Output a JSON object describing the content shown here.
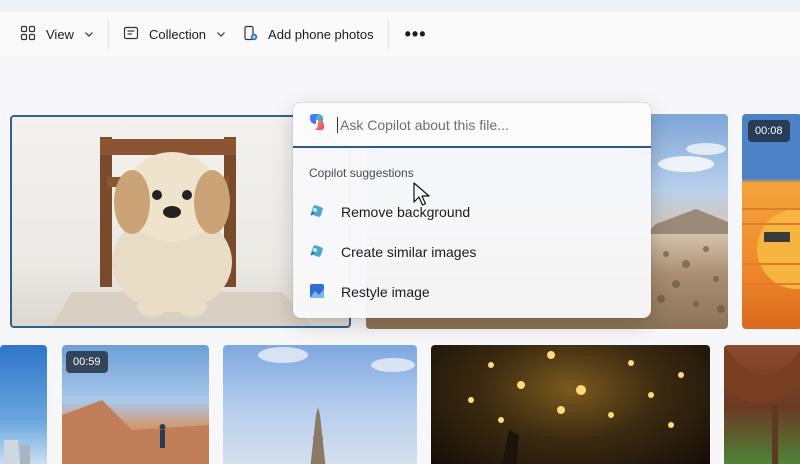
{
  "toolbar": {
    "view_label": "View",
    "collection_label": "Collection",
    "add_phone_label": "Add phone photos",
    "more_label": "•••"
  },
  "tiles": {
    "orange_badge": "00:08",
    "hike_badge": "00:59"
  },
  "copilot": {
    "placeholder": "Ask Copilot about this file...",
    "section_title": "Copilot suggestions",
    "items": [
      {
        "label": "Remove background",
        "icon": "magic-brush-icon"
      },
      {
        "label": "Create similar images",
        "icon": "magic-brush-icon"
      },
      {
        "label": "Restyle image",
        "icon": "restyle-image-icon"
      }
    ]
  },
  "colors": {
    "accent": "#2c5a8a",
    "selection_border": "#33608f"
  }
}
